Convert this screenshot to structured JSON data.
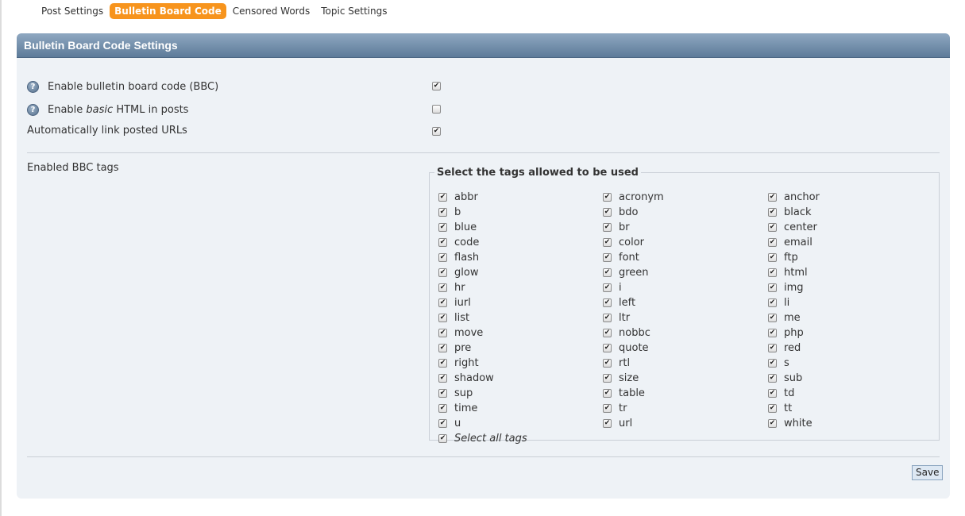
{
  "tabs": [
    {
      "label": "Post Settings",
      "active": false
    },
    {
      "label": "Bulletin Board Code",
      "active": true
    },
    {
      "label": "Censored Words",
      "active": false
    },
    {
      "label": "Topic Settings",
      "active": false
    }
  ],
  "panel": {
    "title": "Bulletin Board Code Settings",
    "options": [
      {
        "label_pre": "Enable bulletin board code (BBC)",
        "label_em": "",
        "label_post": "",
        "help": true,
        "checked": true
      },
      {
        "label_pre": "Enable ",
        "label_em": "basic",
        "label_post": " HTML in posts",
        "help": true,
        "checked": false
      },
      {
        "label_pre": "Automatically link posted URLs",
        "label_em": "",
        "label_post": "",
        "help": false,
        "checked": true
      }
    ],
    "tags_label": "Enabled BBC tags",
    "tags_legend": "Select the tags allowed to be used",
    "tags": [
      "abbr",
      "acronym",
      "anchor",
      "b",
      "bdo",
      "black",
      "blue",
      "br",
      "center",
      "code",
      "color",
      "email",
      "flash",
      "font",
      "ftp",
      "glow",
      "green",
      "html",
      "hr",
      "i",
      "img",
      "iurl",
      "left",
      "li",
      "list",
      "ltr",
      "me",
      "move",
      "nobbc",
      "php",
      "pre",
      "quote",
      "red",
      "right",
      "rtl",
      "s",
      "shadow",
      "size",
      "sub",
      "sup",
      "table",
      "td",
      "time",
      "tr",
      "tt",
      "u",
      "url",
      "white"
    ],
    "select_all_label": "Select all tags",
    "save_label": "Save"
  },
  "colors": {
    "accent": "#f7941d",
    "header": "#5d7b99",
    "panel_bg": "#eef2f6"
  },
  "icons": {
    "help": "help-icon"
  }
}
